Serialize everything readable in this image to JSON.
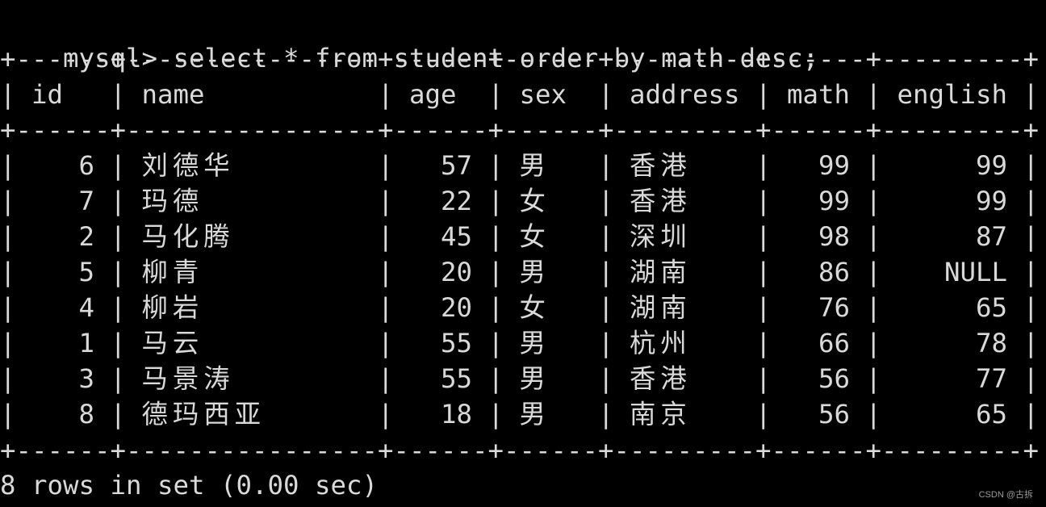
{
  "terminal": {
    "prompt": "mysql>",
    "command": "select * from student order by math desc;",
    "border": "+------+----------------+------+------+---------+------+---------+",
    "columns": [
      "id",
      "name",
      "age",
      "sex",
      "address",
      "math",
      "english"
    ],
    "rows": [
      {
        "id": "6",
        "name": "刘德华",
        "age": "57",
        "sex": "男",
        "address": "香港",
        "math": "99",
        "english": "99"
      },
      {
        "id": "7",
        "name": "玛德",
        "age": "22",
        "sex": "女",
        "address": "香港",
        "math": "99",
        "english": "99"
      },
      {
        "id": "2",
        "name": "马化腾",
        "age": "45",
        "sex": "女",
        "address": "深圳",
        "math": "98",
        "english": "87"
      },
      {
        "id": "5",
        "name": "柳青",
        "age": "20",
        "sex": "男",
        "address": "湖南",
        "math": "86",
        "english": "NULL"
      },
      {
        "id": "4",
        "name": "柳岩",
        "age": "20",
        "sex": "女",
        "address": "湖南",
        "math": "76",
        "english": "65"
      },
      {
        "id": "1",
        "name": "马云",
        "age": "55",
        "sex": "男",
        "address": "杭州",
        "math": "66",
        "english": "78"
      },
      {
        "id": "3",
        "name": "马景涛",
        "age": "55",
        "sex": "男",
        "address": "香港",
        "math": "56",
        "english": "77"
      },
      {
        "id": "8",
        "name": "德玛西亚",
        "age": "18",
        "sex": "男",
        "address": "南京",
        "math": "56",
        "english": "65"
      }
    ],
    "result_summary": "8 rows in set (0.00 sec)"
  },
  "watermark": "CSDN @古拆"
}
